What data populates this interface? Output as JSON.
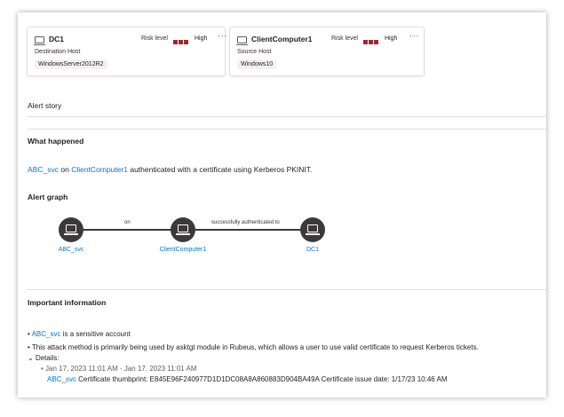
{
  "cards": [
    {
      "name": "DC1",
      "risk_label": "Risk level",
      "risk_value": "High",
      "role": "Destination Host",
      "os": "WindowsServer2012R2"
    },
    {
      "name": "ClientComputer1",
      "risk_label": "Risk level",
      "risk_value": "High",
      "role": "Source Host",
      "os": "Windows10"
    }
  ],
  "more_icon": "...",
  "alert_story_label": "Alert story",
  "what_happened": {
    "heading": "What happened",
    "account": "ABC_svc",
    "on": "on",
    "host": "ClientComputer1",
    "rest": "authenticated with a certificate using Kerberos PKINIT."
  },
  "graph": {
    "heading": "Alert graph",
    "nodes": [
      "ABC_svc",
      "ClientComputer1",
      "DC1"
    ],
    "edges": [
      "on",
      "successfully authenticated to"
    ]
  },
  "important": {
    "heading": "Important information",
    "bullet1_link": "ABC_svc",
    "bullet1_text": "is a sensitive account",
    "bullet2": "This attack method is primarily being used by asktgt module in Rubeus, which allows a user to use valid certificate to request Kerberos tickets.",
    "details_label": "Details:",
    "detail_time": "Jan 17, 2023 11:01 AM - Jan 17, 2023 11:01 AM",
    "detail_link": "ABC_svc",
    "detail_text": "Certificate thumbprint: E845E96F240977D1D1DC08A8A860883D904BA49A Certificate issue date: 1/17/23 10:46 AM"
  },
  "colors": {
    "accent": "#0078d4",
    "risk": "#a4262c",
    "node": "#3b3a39"
  }
}
